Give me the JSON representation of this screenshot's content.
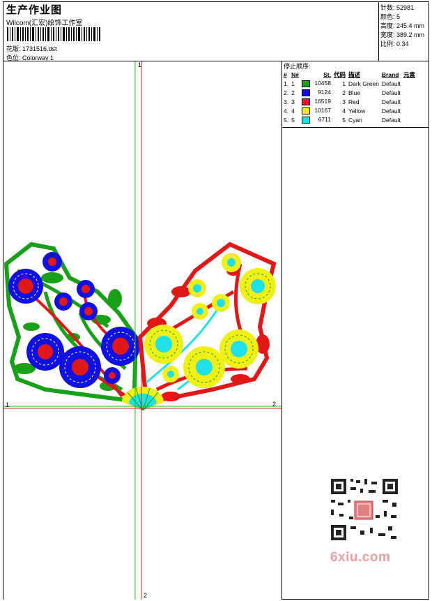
{
  "header": {
    "title": "生产作业图",
    "company": "Wilcom(汇宏)绘饰工作室",
    "design_label": "花版: 1731516.dst",
    "color_label": "色位: Colorway 1"
  },
  "stats": {
    "stitches": "针数: 52981",
    "colors": "颜色: 5",
    "height": "高度: 245.4 mm",
    "width": "宽度: 389.2 mm",
    "scale": "比例: 0.34"
  },
  "stop_sequence": {
    "title": "停止顺序:",
    "columns": [
      "#",
      "N#",
      "St.",
      "代码",
      "描述",
      "Brand",
      "元素"
    ],
    "rows": [
      {
        "idx": "1.",
        "n": "1",
        "color": "#18a018",
        "st": "10458",
        "code": "1",
        "desc": "Dark Green",
        "brand": "Default"
      },
      {
        "idx": "2.",
        "n": "2",
        "color": "#1010e0",
        "st": "9124",
        "code": "2",
        "desc": "Blue",
        "brand": "Default"
      },
      {
        "idx": "3.",
        "n": "3",
        "color": "#e01818",
        "st": "16519",
        "code": "3",
        "desc": "Red",
        "brand": "Default"
      },
      {
        "idx": "4.",
        "n": "4",
        "color": "#f0f018",
        "st": "10167",
        "code": "4",
        "desc": "Yellow",
        "brand": "Default"
      },
      {
        "idx": "5.",
        "n": "5",
        "color": "#20e0e8",
        "st": "6711",
        "code": "5",
        "desc": "Cyan",
        "brand": "Default"
      }
    ]
  },
  "axes": {
    "v_top": "1",
    "v_bottom": "2",
    "h_left": "1",
    "h_right": "2"
  },
  "watermark": "6xiu.com",
  "colors": {
    "green": "#18a018",
    "blue": "#1010e0",
    "red": "#e01818",
    "yellow": "#f0f018",
    "cyan": "#20e0e8"
  }
}
